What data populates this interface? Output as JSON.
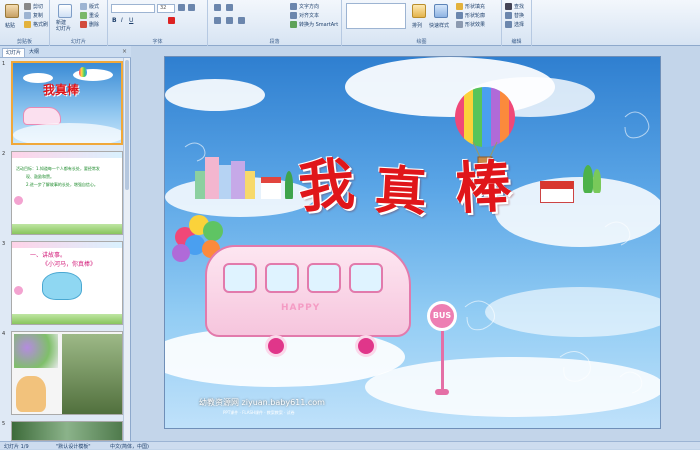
{
  "ribbon": {
    "clipboard": {
      "group_label": "剪贴板",
      "paste_label": "粘贴",
      "cut_label": "剪切",
      "copy_label": "复制",
      "format_painter_label": "格式刷"
    },
    "slides": {
      "group_label": "幻灯片",
      "new_slide_label": "新建\n幻灯片",
      "layout_label": "版式",
      "reset_label": "重设",
      "delete_label": "删除"
    },
    "font": {
      "group_label": "字体",
      "font_size_value": "32"
    },
    "paragraph": {
      "group_label": "段落",
      "text_direction_label": "文字方向",
      "align_text_label": "对齐文本",
      "smartart_label": "转换为 SmartArt"
    },
    "drawing": {
      "group_label": "绘图",
      "arrange_label": "排列",
      "quick_styles_label": "快速样式",
      "shape_fill_label": "形状填充",
      "shape_outline_label": "形状轮廓",
      "shape_effects_label": "形状效果"
    },
    "editing": {
      "group_label": "编辑",
      "find_label": "查找",
      "replace_label": "替换",
      "select_label": "选择"
    }
  },
  "left_panel": {
    "tabs": [
      {
        "label": "幻灯片"
      },
      {
        "label": "大纲"
      }
    ],
    "close_symbol": "×",
    "thumbnails": [
      {
        "number": "1",
        "title": "我真棒"
      },
      {
        "number": "2",
        "lines": [
          "活动目标：1.知道每一个人都有长处，要经常发",
          "现、鼓励和赞。",
          "2.进一步了解故事的长处，增强自信心。"
        ]
      },
      {
        "number": "3",
        "lines": [
          "一、讲故事。",
          "《小河马，你真棒》"
        ]
      },
      {
        "number": "4"
      },
      {
        "number": "5"
      }
    ]
  },
  "slide": {
    "title_chars": [
      "我",
      "真",
      "棒"
    ],
    "bus_text": "HAPPY",
    "bus_sign": "BUS",
    "watermark": "幼教资源网 ziyuan.baby611.com",
    "watermark_sub": "PPT课件 · FLASH课件 · 教案教案 · 试卷"
  },
  "status_bar": {
    "slide_info": "幻灯片 1/9",
    "theme": "\"默认设计模板\"",
    "language": "中文(简体，中国)"
  },
  "colors": {
    "ribbon_bg": "#dce7f4",
    "title_red": "#e0161a",
    "sky_top": "#3f8fd6",
    "selection": "#f0a83a"
  }
}
